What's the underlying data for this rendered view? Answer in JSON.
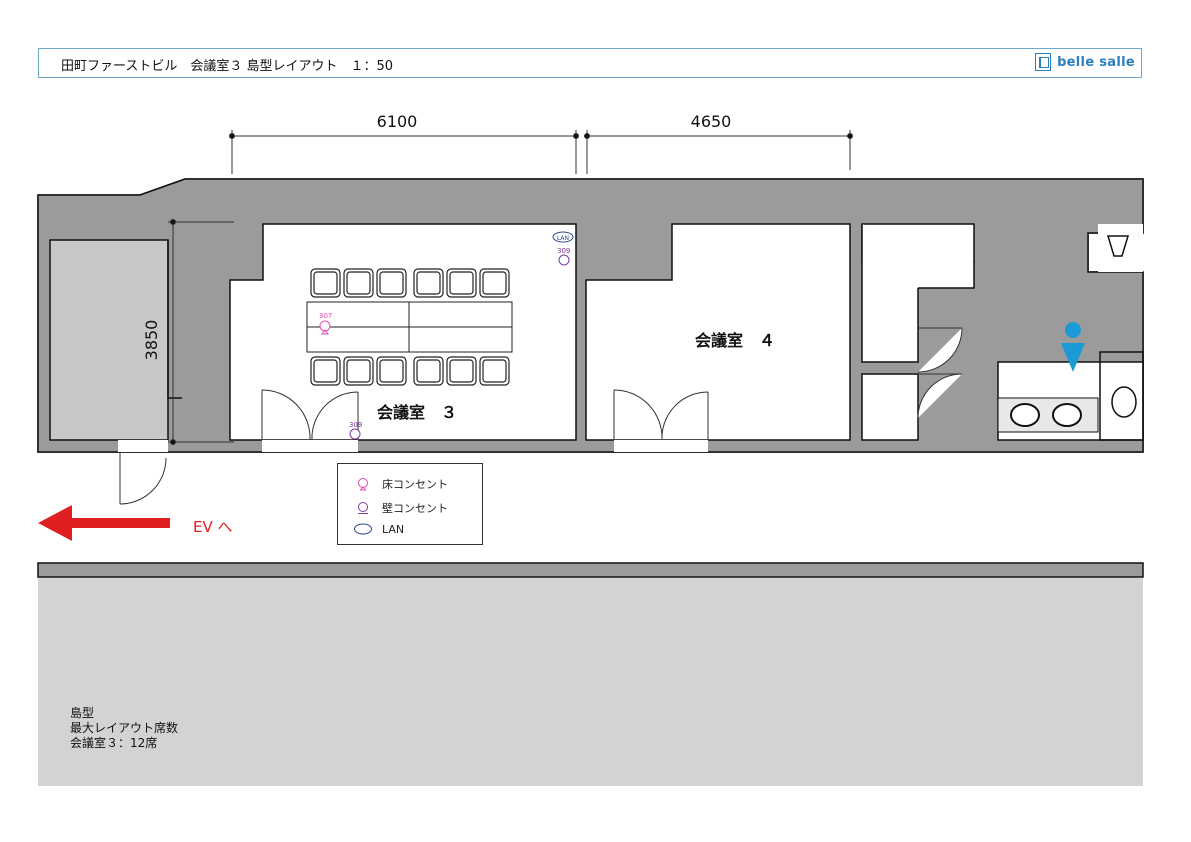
{
  "header": {
    "title": "田町ファーストビル　会議室３ 島型レイアウト　１：50",
    "logo_text": "belle salle"
  },
  "dimensions": {
    "width_a": "6100",
    "width_b": "4650",
    "height": "3850"
  },
  "rooms": {
    "room3": "会議室　３",
    "room4": "会議室　４"
  },
  "outlets": {
    "floor_number": "307",
    "wall_number_top": "309",
    "wall_number_bottom": "309",
    "lan": "LAN"
  },
  "legend": {
    "floor_outlet": "床コンセント",
    "wall_outlet": "壁コンセント",
    "lan": "LAN"
  },
  "ev_label": "EV へ",
  "notes": {
    "line1": "島型",
    "line2": "最大レイアウト席数",
    "line3": "会議室３：12席"
  },
  "colors": {
    "wall": "#9b9b9b",
    "corridor": "#d3d3d5",
    "accent_blue": "#2a7fbf",
    "restroom_icon": "#1a9ad6",
    "arrow_red": "#e02020",
    "floor_outlet": "#e24bb5",
    "wall_outlet": "#7a3aa0"
  }
}
